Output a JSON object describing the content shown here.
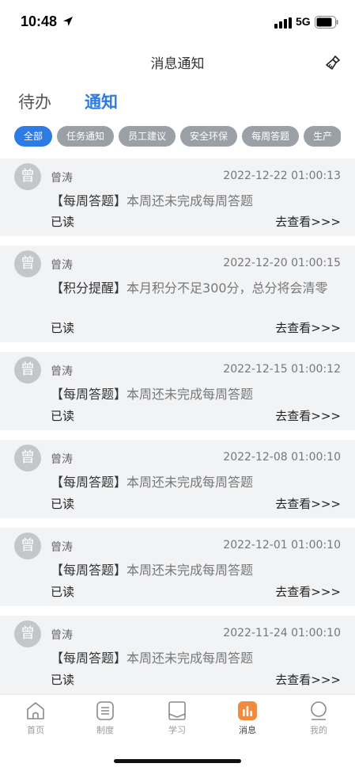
{
  "status_bar": {
    "time": "10:48",
    "network": "5G"
  },
  "header": {
    "title": "消息通知",
    "clear_icon": "broom-icon"
  },
  "tabs": {
    "todo": "待办",
    "notice": "通知"
  },
  "chips": [
    {
      "label": "全部",
      "active": true
    },
    {
      "label": "任务通知",
      "active": false
    },
    {
      "label": "员工建议",
      "active": false
    },
    {
      "label": "安全环保",
      "active": false
    },
    {
      "label": "每周答题",
      "active": false
    },
    {
      "label": "生产",
      "active": false
    }
  ],
  "messages": [
    {
      "avatar": "曾",
      "sender": "曾涛",
      "time": "2022-12-22 01:00:13",
      "tag": "【每周答题】",
      "text": "本周还未完成每周答题",
      "status": "已读",
      "link": "去查看>>>"
    },
    {
      "avatar": "曾",
      "sender": "曾涛",
      "time": "2022-12-20 01:00:15",
      "tag": "【积分提醒】",
      "text": "本月积分不足300分，总分将会清零",
      "status": "已读",
      "link": "去查看>>>"
    },
    {
      "avatar": "曾",
      "sender": "曾涛",
      "time": "2022-12-15 01:00:12",
      "tag": "【每周答题】",
      "text": "本周还未完成每周答题",
      "status": "已读",
      "link": "去查看>>>"
    },
    {
      "avatar": "曾",
      "sender": "曾涛",
      "time": "2022-12-08 01:00:10",
      "tag": "【每周答题】",
      "text": "本周还未完成每周答题",
      "status": "已读",
      "link": "去查看>>>"
    },
    {
      "avatar": "曾",
      "sender": "曾涛",
      "time": "2022-12-01 01:00:10",
      "tag": "【每周答题】",
      "text": "本周还未完成每周答题",
      "status": "已读",
      "link": "去查看>>>"
    },
    {
      "avatar": "曾",
      "sender": "曾涛",
      "time": "2022-11-24 01:00:10",
      "tag": "【每周答题】",
      "text": "本周还未完成每周答题",
      "status": "已读",
      "link": "去查看>>>"
    }
  ],
  "tabbar": {
    "home": "首页",
    "rules": "制度",
    "study": "学习",
    "messages": "消息",
    "mine": "我的",
    "active": "messages",
    "active_color": "#f08a3c"
  },
  "colors": {
    "accent": "#2d7be5",
    "chip_inactive": "#9aa0a6",
    "card_bg": "#f2f3f5"
  }
}
